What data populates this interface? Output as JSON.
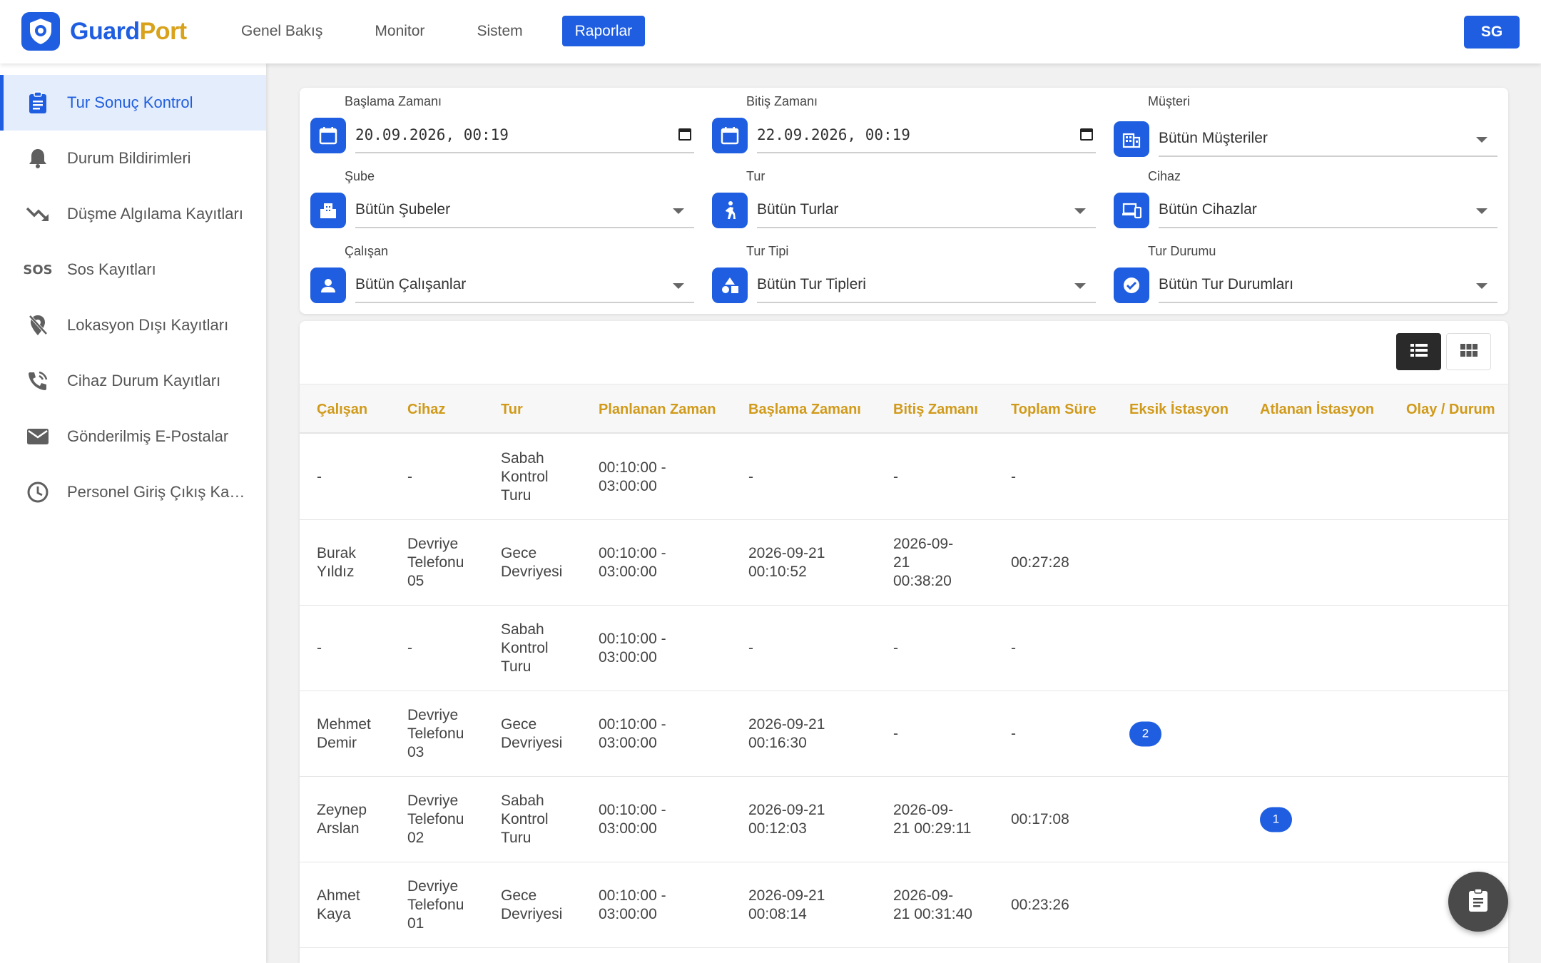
{
  "app": {
    "brand_part1": "Guard",
    "brand_part2": "Port"
  },
  "nav": {
    "items": [
      "Genel Bakış",
      "Monitor",
      "Sistem",
      "Raporlar"
    ],
    "active": "Raporlar"
  },
  "user": {
    "initials": "SG"
  },
  "sidebar": {
    "items": [
      {
        "label": "Tur Sonuç Kontrol",
        "icon": "clipboard-icon"
      },
      {
        "label": "Durum Bildirimleri",
        "icon": "bell-icon"
      },
      {
        "label": "Düşme Algılama Kayıtları",
        "icon": "trending-down-icon"
      },
      {
        "label": "Sos Kayıtları",
        "icon": "sos-icon"
      },
      {
        "label": "Lokasyon Dışı Kayıtları",
        "icon": "location-off-icon"
      },
      {
        "label": "Cihaz Durum Kayıtları",
        "icon": "phone-call-icon"
      },
      {
        "label": "Gönderilmiş E-Postalar",
        "icon": "mail-icon"
      },
      {
        "label": "Personel Giriş Çıkış Kayıtları",
        "icon": "clock-icon"
      }
    ]
  },
  "filters": {
    "start": {
      "label": "Başlama Zamanı",
      "value": "20.09.2026, 00:19"
    },
    "end": {
      "label": "Bitiş Zamanı",
      "value": "22.09.2026, 00:19"
    },
    "customer": {
      "label": "Müşteri",
      "value": "Bütün Müşteriler"
    },
    "branch": {
      "label": "Şube",
      "value": "Bütün Şubeler"
    },
    "tour": {
      "label": "Tur",
      "value": "Bütün Turlar"
    },
    "device": {
      "label": "Cihaz",
      "value": "Bütün Cihazlar"
    },
    "employee": {
      "label": "Çalışan",
      "value": "Bütün Çalışanlar"
    },
    "tour_type": {
      "label": "Tur Tipi",
      "value": "Bütün Tur Tipleri"
    },
    "tour_status": {
      "label": "Tur Durumu",
      "value": "Bütün Tur Durumları"
    }
  },
  "table": {
    "headers": [
      "Çalışan",
      "Cihaz",
      "Tur",
      "Planlanan Zaman",
      "Başlama Zamanı",
      "Bitiş Zamanı",
      "Toplam Süre",
      "Eksik İstasyon",
      "Atlanan İstasyon",
      "Olay / Durum"
    ],
    "rows": [
      {
        "employee": [
          "-"
        ],
        "device": [
          "-"
        ],
        "tour": [
          "Sabah",
          "Kontrol",
          "Turu"
        ],
        "planned": [
          "00:10:00 -",
          "03:00:00"
        ],
        "start": [
          "-"
        ],
        "end": [
          "-"
        ],
        "total": "-",
        "missing": "",
        "skipped": "",
        "event": ""
      },
      {
        "employee": [
          "Burak",
          "Yıldız"
        ],
        "device": [
          "Devriye",
          "Telefonu",
          "05"
        ],
        "tour": [
          "Gece",
          "Devriyesi"
        ],
        "planned": [
          "00:10:00 -",
          "03:00:00"
        ],
        "start": [
          "2026-09-21",
          "00:10:52"
        ],
        "end": [
          "2026-09-",
          "21",
          "00:38:20"
        ],
        "total": "00:27:28",
        "missing": "",
        "skipped": "",
        "event": ""
      },
      {
        "employee": [
          "-"
        ],
        "device": [
          "-"
        ],
        "tour": [
          "Sabah",
          "Kontrol",
          "Turu"
        ],
        "planned": [
          "00:10:00 -",
          "03:00:00"
        ],
        "start": [
          "-"
        ],
        "end": [
          "-"
        ],
        "total": "-",
        "missing": "",
        "skipped": "",
        "event": ""
      },
      {
        "employee": [
          "Mehmet",
          "Demir"
        ],
        "device": [
          "Devriye",
          "Telefonu",
          "03"
        ],
        "tour": [
          "Gece",
          "Devriyesi"
        ],
        "planned": [
          "00:10:00 -",
          "03:00:00"
        ],
        "start": [
          "2026-09-21",
          "00:16:30"
        ],
        "end": [
          "-"
        ],
        "total": "-",
        "missing": "2",
        "skipped": "",
        "event": ""
      },
      {
        "employee": [
          "Zeynep",
          "Arslan"
        ],
        "device": [
          "Devriye",
          "Telefonu",
          "02"
        ],
        "tour": [
          "Sabah",
          "Kontrol",
          "Turu"
        ],
        "planned": [
          "00:10:00 -",
          "03:00:00"
        ],
        "start": [
          "2026-09-21",
          "00:12:03"
        ],
        "end": [
          "2026-09-",
          "21 00:29:11"
        ],
        "total": "00:17:08",
        "missing": "",
        "skipped": "1",
        "event": ""
      },
      {
        "employee": [
          "Ahmet",
          "Kaya"
        ],
        "device": [
          "Devriye",
          "Telefonu",
          "01"
        ],
        "tour": [
          "Gece",
          "Devriyesi"
        ],
        "planned": [
          "00:10:00 -",
          "03:00:00"
        ],
        "start": [
          "2026-09-21",
          "00:08:14"
        ],
        "end": [
          "2026-09-",
          "21 00:31:40"
        ],
        "total": "00:23:26",
        "missing": "",
        "skipped": "",
        "event": ""
      }
    ]
  },
  "colors": {
    "primary": "#1f5ee0",
    "accent": "#d09a1a",
    "active_bg": "#e4edfb"
  }
}
